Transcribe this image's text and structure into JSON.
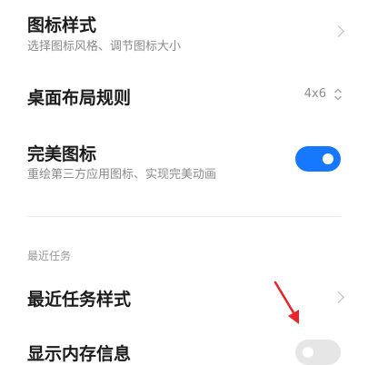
{
  "settings": {
    "icon_style": {
      "title": "图标样式",
      "subtitle": "选择图标风格、调节图标大小"
    },
    "desktop_layout": {
      "title": "桌面布局规则",
      "value": "4x6"
    },
    "perfect_icons": {
      "title": "完美图标",
      "subtitle": "重绘第三方应用图标、实现完美动画",
      "enabled": true
    },
    "recent_tasks_section": {
      "label": "最近任务"
    },
    "recent_task_style": {
      "title": "最近任务样式"
    },
    "show_memory_info": {
      "title": "显示内存信息",
      "enabled": false
    }
  },
  "colors": {
    "toggle_on": "#1677ff",
    "toggle_off": "#e6e6e6",
    "annotation_arrow": "#e8262a"
  }
}
